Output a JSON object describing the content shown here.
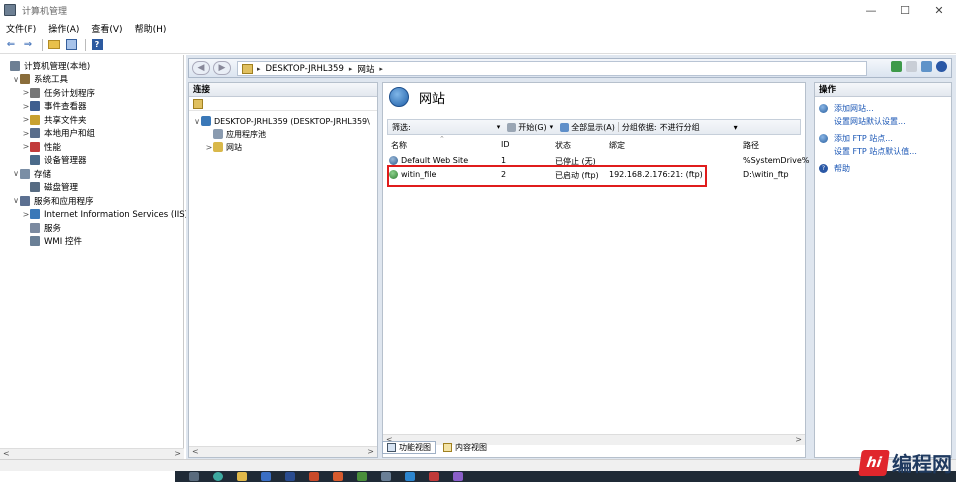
{
  "window": {
    "title": "计算机管理",
    "controls": {
      "minimize": "—",
      "maximize": "☐",
      "close": "✕"
    }
  },
  "menu": [
    "文件(F)",
    "操作(A)",
    "查看(V)",
    "帮助(H)"
  ],
  "toolbar": {
    "back": "⇐",
    "forward": "⇒",
    "help": "?"
  },
  "left_tree": [
    {
      "label": "计算机管理(本地)",
      "arrow": "",
      "icon_color": "#6d7f93",
      "indent": 0
    },
    {
      "label": "系统工具",
      "arrow": "∨",
      "icon_color": "#8a6d3b",
      "indent": 1
    },
    {
      "label": "任务计划程序",
      "arrow": ">",
      "icon_color": "#777777",
      "indent": 2
    },
    {
      "label": "事件查看器",
      "arrow": ">",
      "icon_color": "#3f5f8f",
      "indent": 2
    },
    {
      "label": "共享文件夹",
      "arrow": ">",
      "icon_color": "#c9a12f",
      "indent": 2
    },
    {
      "label": "本地用户和组",
      "arrow": ">",
      "icon_color": "#5a6e8c",
      "indent": 2
    },
    {
      "label": "性能",
      "arrow": ">",
      "icon_color": "#c23b3b",
      "indent": 2
    },
    {
      "label": "设备管理器",
      "arrow": "",
      "icon_color": "#4a6a8a",
      "indent": 2
    },
    {
      "label": "存储",
      "arrow": "∨",
      "icon_color": "#7a8ea5",
      "indent": 1
    },
    {
      "label": "磁盘管理",
      "arrow": "",
      "icon_color": "#566b82",
      "indent": 2
    },
    {
      "label": "服务和应用程序",
      "arrow": "∨",
      "icon_color": "#5c7091",
      "indent": 1
    },
    {
      "label": "Internet Information Services (IIS)管",
      "arrow": ">",
      "icon_color": "#3a78b8",
      "indent": 2
    },
    {
      "label": "服务",
      "arrow": "",
      "icon_color": "#7b8aa0",
      "indent": 2
    },
    {
      "label": "WMI 控件",
      "arrow": "",
      "icon_color": "#6a7f96",
      "indent": 2
    }
  ],
  "scroll_arrows": {
    "left": "<",
    "right": ">"
  },
  "address": {
    "segments": [
      "DESKTOP-JRHL359",
      "网站"
    ],
    "separator": "▸"
  },
  "connections": {
    "header": "连接",
    "tree": [
      {
        "label": "DESKTOP-JRHL359 (DESKTOP-JRHL359\\",
        "arrow": "∨",
        "indent": 0,
        "icon_color": "#3a78b8"
      },
      {
        "label": "应用程序池",
        "arrow": "",
        "indent": 1,
        "icon_color": "#8a9bb0"
      },
      {
        "label": "网站",
        "arrow": ">",
        "indent": 1,
        "icon_color": "#d9b84a"
      }
    ]
  },
  "sites": {
    "title": "网站",
    "filter_label": "筛选:",
    "start_label": "开始(G)",
    "show_all_label": "全部显示(A)",
    "group_label": "分组依据:",
    "group_value": "不进行分组",
    "columns": [
      "名称",
      "ID",
      "状态",
      "绑定",
      "路径"
    ],
    "rows": [
      {
        "name": "Default Web Site",
        "id": "1",
        "status": "已停止 (无)",
        "binding": "",
        "path": "%SystemDrive%",
        "stopped": true
      },
      {
        "name": "witin_file",
        "id": "2",
        "status": "已启动 (ftp)",
        "binding": "192.168.2.176:21: (ftp)",
        "path": "D:\\witin_ftp",
        "stopped": false
      }
    ],
    "tabs": [
      "功能视图",
      "内容视图"
    ]
  },
  "actions": {
    "header": "操作",
    "items": [
      {
        "label": "添加网站...",
        "sub": "设置网站默认设置..."
      },
      {
        "label": "添加 FTP 站点...",
        "sub": "设置 FTP 站点默认值..."
      },
      {
        "label": "帮助",
        "sub": ""
      }
    ]
  },
  "watermark": {
    "logo": "hi",
    "text": "编程网"
  },
  "colors": {
    "highlight": "#e01c1c",
    "link": "#1a56b5"
  }
}
